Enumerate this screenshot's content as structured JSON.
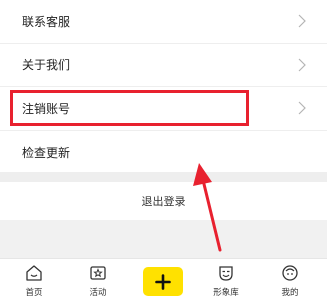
{
  "settings_menu": {
    "items": [
      {
        "label": "联系客服"
      },
      {
        "label": "关于我们"
      },
      {
        "label": "注销账号"
      },
      {
        "label": "检查更新"
      }
    ]
  },
  "logout": {
    "label": "退出登录"
  },
  "annotation": {
    "highlight_color": "#e8212f"
  },
  "tabbar": {
    "home": {
      "label": "首页",
      "icon": "home-icon"
    },
    "activity": {
      "label": "活动",
      "icon": "activity-icon"
    },
    "add": {
      "icon": "plus-icon",
      "color": "#ffe100"
    },
    "avatar_library": {
      "label": "形象库",
      "icon": "mask-icon"
    },
    "profile": {
      "label": "我的",
      "icon": "profile-face-icon"
    }
  }
}
